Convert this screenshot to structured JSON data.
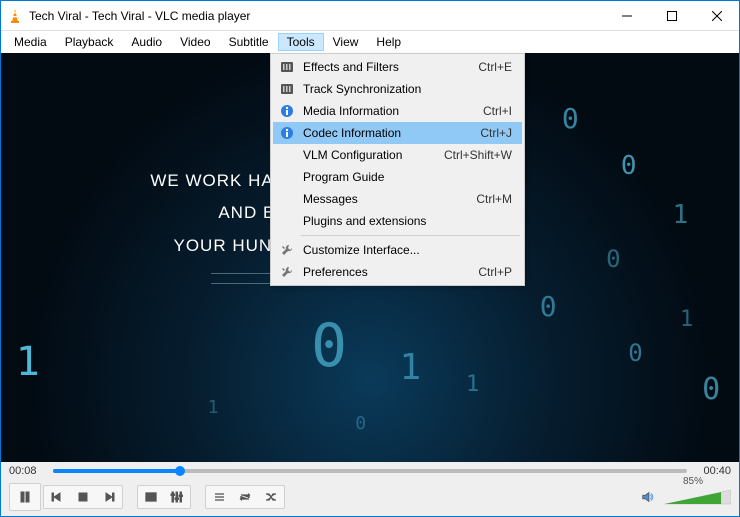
{
  "title": "Tech Viral - Tech Viral - VLC media player",
  "menubar": [
    "Media",
    "Playback",
    "Audio",
    "Video",
    "Subtitle",
    "Tools",
    "View",
    "Help"
  ],
  "active_menu_index": 5,
  "dropdown": {
    "items": [
      {
        "icon": "eq",
        "label": "Effects and Filters",
        "shortcut": "Ctrl+E"
      },
      {
        "icon": "eq",
        "label": "Track Synchronization",
        "shortcut": ""
      },
      {
        "icon": "info",
        "label": "Media Information",
        "shortcut": "Ctrl+I"
      },
      {
        "icon": "info",
        "label": "Codec Information",
        "shortcut": "Ctrl+J",
        "highlighted": true
      },
      {
        "icon": "",
        "label": "VLM Configuration",
        "shortcut": "Ctrl+Shift+W"
      },
      {
        "icon": "",
        "label": "Program Guide",
        "shortcut": ""
      },
      {
        "icon": "",
        "label": "Messages",
        "shortcut": "Ctrl+M"
      },
      {
        "icon": "",
        "label": "Plugins and extensions",
        "shortcut": ""
      },
      {
        "sep": true
      },
      {
        "icon": "wrench",
        "label": "Customize Interface...",
        "shortcut": ""
      },
      {
        "icon": "wrench",
        "label": "Preferences",
        "shortcut": "Ctrl+P"
      }
    ]
  },
  "video_overlay": {
    "line1": "WE WORK HARD TO",
    "line2": "AND BEST O",
    "line3": "YOUR HUNGER C"
  },
  "time": {
    "current": "00:08",
    "total": "00:40",
    "progress_pct": 20
  },
  "volume": {
    "percent": "85%",
    "level": 0.85
  }
}
